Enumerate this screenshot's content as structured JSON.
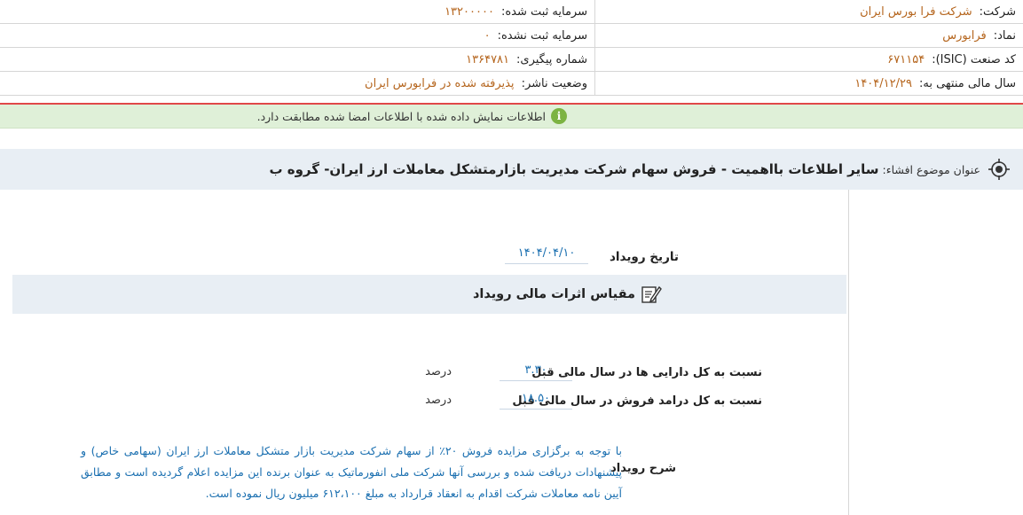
{
  "company_info": {
    "right": [
      {
        "label": "شرکت:",
        "value": "شرکت فرا بورس ایران"
      },
      {
        "label": "نماد:",
        "value": "فرابورس"
      },
      {
        "label": "کد صنعت (ISIC):",
        "value": "۶۷۱۱۵۴"
      },
      {
        "label": "سال مالی منتهی به:",
        "value": "۱۴۰۴/۱۲/۲۹"
      }
    ],
    "left": [
      {
        "label": "سرمایه ثبت شده:",
        "value": "۱۳۲۰۰۰۰۰"
      },
      {
        "label": "سرمایه ثبت نشده:",
        "value": "۰"
      },
      {
        "label": "شماره پیگیری:",
        "value": "۱۳۶۴۷۸۱"
      },
      {
        "label": "وضعیت ناشر:",
        "value": "پذیرفته شده در فرابورس ایران"
      }
    ]
  },
  "notice": {
    "icon": "info-icon",
    "text": "اطلاعات نمایش داده شده با اطلاعات امضا شده مطابقت دارد."
  },
  "subject": {
    "label": "عنوان موضوع افشاء:",
    "title": "سایر اطلاعات بااهمیت - فروش سهام شرکت مدیریت بازارمتشکل معاملات ارز ایران- گروه ب"
  },
  "event": {
    "date_label": "تاریخ رویداد",
    "date_value": "۱۴۰۴/۰۴/۱۰"
  },
  "section": {
    "title": "مقیاس اثرات مالی رویداد"
  },
  "metrics": [
    {
      "label": "نسبت به کل دارایی ها در سال مالی قبل",
      "value": "۳.۳۰",
      "unit": "درصد"
    },
    {
      "label": "نسبت به کل درامد فروش در سال مالی قبل",
      "value": "۱۸.۵۰",
      "unit": "درصد"
    }
  ],
  "description": {
    "label": "شرح رویداد",
    "text": "با توجه به برگزاری مزایده فروش ۲۰٪ از سهام شرکت مدیریت بازار متشکل معاملات ارز ایران (سهامی خاص) و پیشنهادات دریافت شده و بررسی آنها شرکت ملی انفورماتیک به عنوان برنده این مزایده اعلام گردیده است و مطابق آیین نامه معاملات شرکت اقدام به انعقاد قرارداد به مبلغ ۶۱۲،۱۰۰ میلیون ریال نموده است."
  },
  "colors": {
    "value_orange": "#b5651d",
    "value_blue": "#1a6fb0",
    "notice_bg": "#dff0d8",
    "accent_red": "#e04848"
  }
}
